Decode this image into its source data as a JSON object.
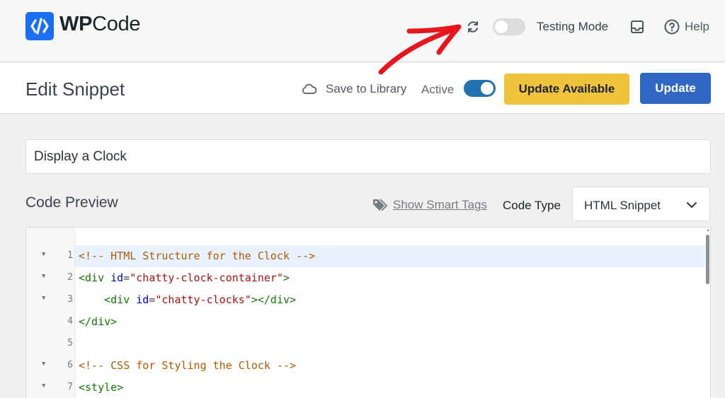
{
  "brand": {
    "prefix": "WP",
    "suffix": "Code",
    "color": "#1b6ff3"
  },
  "topbar": {
    "testing_mode_label": "Testing Mode",
    "help_label": "Help"
  },
  "header": {
    "title": "Edit Snippet",
    "save_to_library": "Save to Library",
    "active_label": "Active",
    "update_available_label": "Update Available",
    "update_label": "Update"
  },
  "snippet": {
    "title": "Display a Clock"
  },
  "code_preview": {
    "title": "Code Preview",
    "smart_tags_label": "Show Smart Tags",
    "code_type_label": "Code Type",
    "code_type_value": "HTML Snippet"
  },
  "code_lines": [
    {
      "num": "1",
      "fold": true,
      "text": "<!-- HTML Structure for the Clock -->"
    },
    {
      "num": "2",
      "fold": true,
      "text": "<div id=\"chatty-clock-container\">"
    },
    {
      "num": "3",
      "fold": true,
      "text": "    <div id=\"chatty-clocks\"></div>"
    },
    {
      "num": "4",
      "fold": false,
      "text": "</div>"
    },
    {
      "num": "5",
      "fold": false,
      "text": ""
    },
    {
      "num": "6",
      "fold": true,
      "text": "<!-- CSS for Styling the Clock -->"
    },
    {
      "num": "7",
      "fold": true,
      "text": "<style>"
    }
  ],
  "colors": {
    "update_available": "#f0c33c",
    "update": "#3067c4",
    "toggle_active": "#2271b1",
    "annotation": "#e8161c"
  }
}
